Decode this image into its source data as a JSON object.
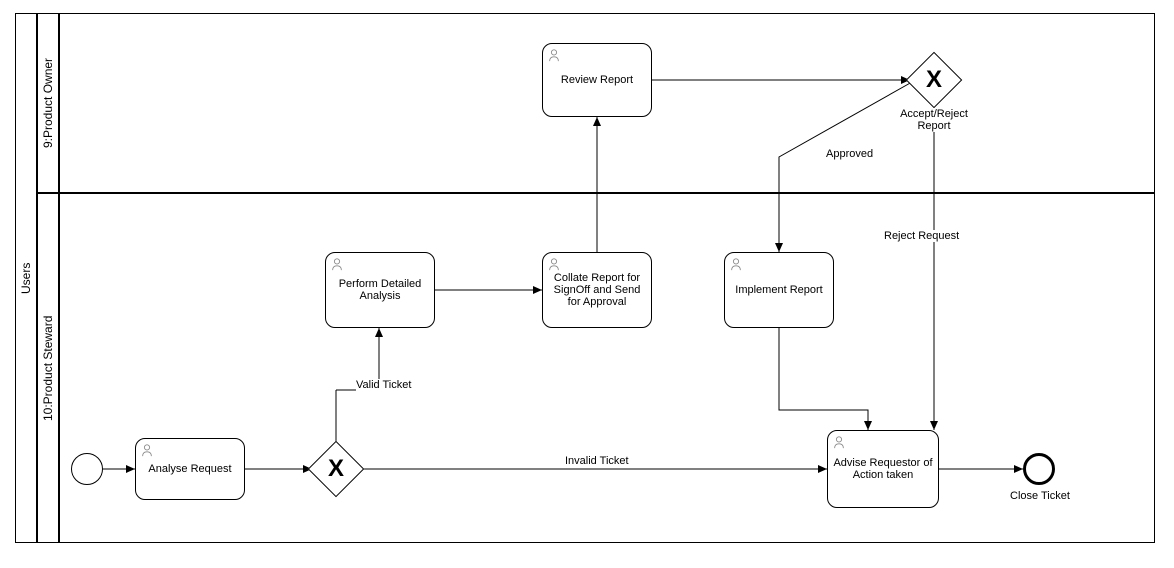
{
  "pool": {
    "name": "Users"
  },
  "lanes": {
    "productOwner": {
      "label": "9:Product Owner"
    },
    "productSteward": {
      "label": "10:Product Steward"
    }
  },
  "tasks": {
    "analyseRequest": {
      "label": "Analyse Request"
    },
    "performDetailedAnalysis": {
      "label": "Perform Detailed Analysis"
    },
    "collateReport": {
      "label": "Collate Report for SignOff and Send for Approval"
    },
    "reviewReport": {
      "label": "Review Report"
    },
    "implementReport": {
      "label": "Implement Report"
    },
    "adviseRequestor": {
      "label": "Advise Requestor of Action taken"
    }
  },
  "gateways": {
    "validateTicket": {
      "marker": "X"
    },
    "acceptRejectReport": {
      "marker": "X",
      "label": "Accept/Reject Report"
    }
  },
  "flowLabels": {
    "validTicket": "Valid Ticket",
    "invalidTicket": "Invalid Ticket",
    "approved": "Approved",
    "rejectRequest": "Reject Request"
  },
  "events": {
    "closeTicket": {
      "label": "Close Ticket"
    }
  }
}
